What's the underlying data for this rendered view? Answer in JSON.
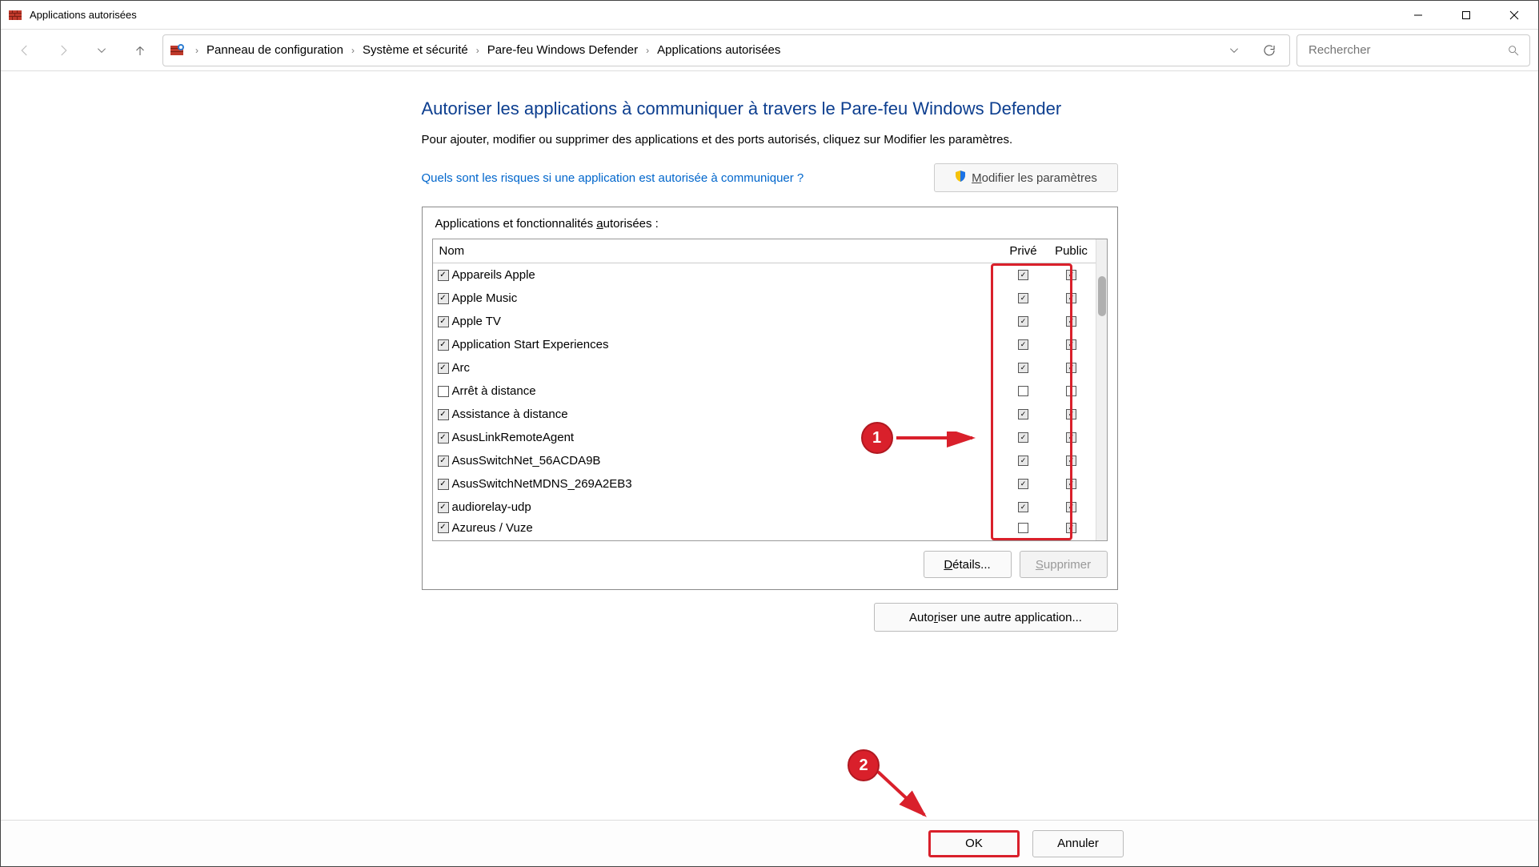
{
  "window": {
    "title": "Applications autorisées"
  },
  "breadcrumb": {
    "items": [
      "Panneau de configuration",
      "Système et sécurité",
      "Pare-feu Windows Defender",
      "Applications autorisées"
    ]
  },
  "search": {
    "placeholder": "Rechercher"
  },
  "page": {
    "heading": "Autoriser les applications à communiquer à travers le Pare-feu Windows Defender",
    "subtitle": "Pour ajouter, modifier ou supprimer des applications et des ports autorisés, cliquez sur Modifier les paramètres.",
    "risk_link": "Quels sont les risques si une application est autorisée à communiquer ?",
    "modify_settings": "Modifier les paramètres"
  },
  "group": {
    "label_prefix": "Applications et fonctionnalités ",
    "label_ul": "a",
    "label_suffix": "utorisées :"
  },
  "columns": {
    "name": "Nom",
    "private": "Privé",
    "public": "Public"
  },
  "apps": [
    {
      "name": "Appareils Apple",
      "enabled": true,
      "private": true,
      "public": true
    },
    {
      "name": "Apple Music",
      "enabled": true,
      "private": true,
      "public": true
    },
    {
      "name": "Apple TV",
      "enabled": true,
      "private": true,
      "public": true
    },
    {
      "name": "Application Start Experiences",
      "enabled": true,
      "private": true,
      "public": true
    },
    {
      "name": "Arc",
      "enabled": true,
      "private": true,
      "public": true
    },
    {
      "name": "Arrêt à distance",
      "enabled": false,
      "private": false,
      "public": false
    },
    {
      "name": "Assistance à distance",
      "enabled": true,
      "private": true,
      "public": true
    },
    {
      "name": "AsusLinkRemoteAgent",
      "enabled": true,
      "private": true,
      "public": true
    },
    {
      "name": "AsusSwitchNet_56ACDA9B",
      "enabled": true,
      "private": true,
      "public": true
    },
    {
      "name": "AsusSwitchNetMDNS_269A2EB3",
      "enabled": true,
      "private": true,
      "public": true
    },
    {
      "name": "audiorelay-udp",
      "enabled": true,
      "private": true,
      "public": true
    },
    {
      "name": "Azureus / Vuze",
      "enabled": true,
      "private": false,
      "public": true
    }
  ],
  "buttons": {
    "details": "Détails...",
    "delete": "Supprimer",
    "allow_another": "Autoriser une autre application...",
    "ok": "OK",
    "cancel": "Annuler"
  },
  "annotations": {
    "badge1": "1",
    "badge2": "2"
  }
}
